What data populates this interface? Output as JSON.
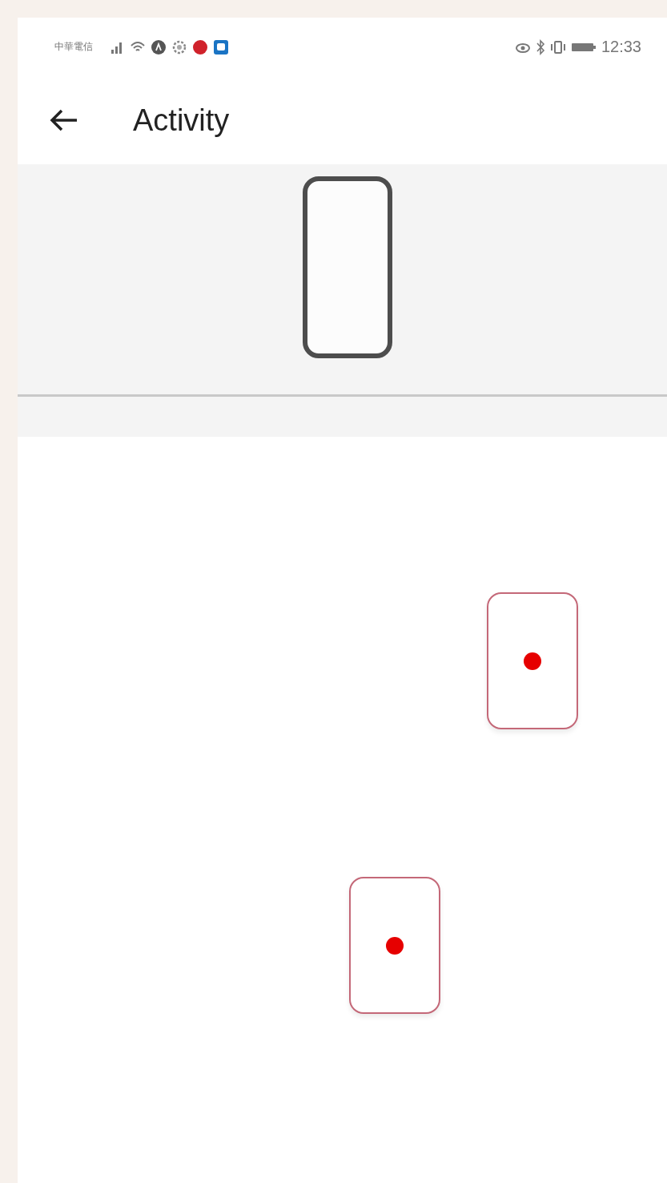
{
  "status_bar": {
    "carrier": "中華電信",
    "time": "12:33"
  },
  "app_bar": {
    "title": "Activity"
  },
  "canvas": {
    "cards": [
      {
        "kind": "dot"
      },
      {
        "kind": "dot"
      }
    ]
  }
}
